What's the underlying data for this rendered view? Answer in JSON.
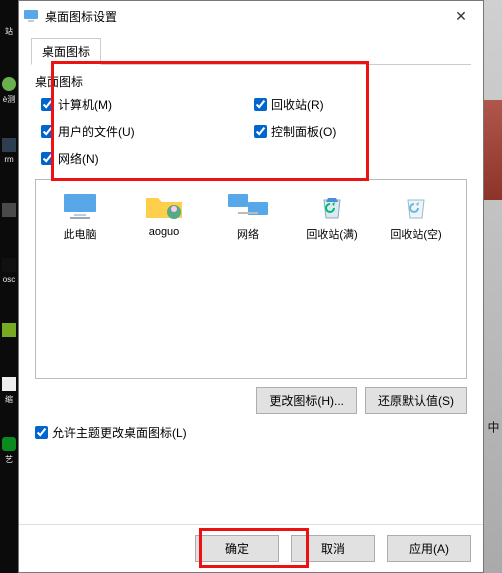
{
  "window": {
    "title": "桌面图标设置",
    "close": "✕"
  },
  "tabs": {
    "t0": "桌面图标"
  },
  "group": {
    "label": "桌面图标",
    "checks": {
      "computer": "计算机(M)",
      "recycle": "回收站(R)",
      "userfiles": "用户的文件(U)",
      "control": "控制面板(O)",
      "network": "网络(N)"
    }
  },
  "preview": {
    "items": {
      "pc": "此电脑",
      "user": "aoguo",
      "net": "网络",
      "binFull": "回收站(满)",
      "binEmpty": "回收站(空)"
    }
  },
  "buttons": {
    "changeIcon": "更改图标(H)...",
    "restore": "还原默认值(S)",
    "allowThemes": "允许主题更改桌面图标(L)",
    "ok": "确定",
    "cancel": "取消",
    "apply": "应用(A)"
  },
  "rightSliver": {
    "cn": "中"
  }
}
